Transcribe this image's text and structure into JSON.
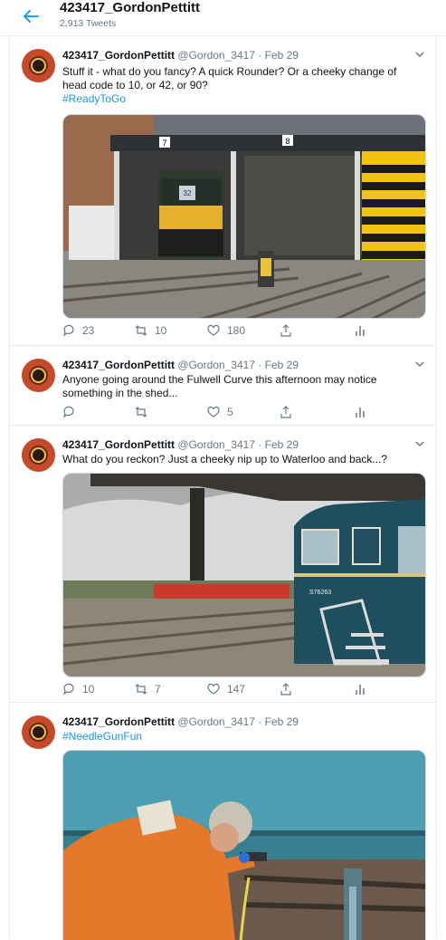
{
  "header": {
    "title": "423417_GordonPettitt",
    "tweet_count": "2,913 Tweets",
    "accent": "#1da1f2"
  },
  "tweets": [
    {
      "name": "423417_GordonPettitt",
      "handle": "@Gordon_3417",
      "sep": "·",
      "date": "Feb 29",
      "line1": "Stuff it - what do you fancy? A quick Rounder? Or a cheeky change of",
      "line2": "head code to 10, or 42, or 90?",
      "hashtag": "#ReadyToGo",
      "replies": "23",
      "retweets": "10",
      "likes": "180",
      "media_desc": "train depot"
    },
    {
      "name": "423417_GordonPettitt",
      "handle": "@Gordon_3417",
      "sep": "·",
      "date": "Feb 29",
      "line1": "Anyone going around the Fulwell Curve this afternoon may notice",
      "line2": "something in the shed...",
      "replies": "",
      "retweets": "",
      "likes": "5"
    },
    {
      "name": "423417_GordonPettitt",
      "handle": "@Gordon_3417",
      "sep": "·",
      "date": "Feb 29",
      "line1": "What do you reckon? Just a cheeky nip up to Waterloo and back...?",
      "replies": "10",
      "retweets": "7",
      "likes": "147",
      "unit_number": "S76263"
    },
    {
      "name": "423417_GordonPettitt",
      "handle": "@Gordon_3417",
      "sep": "·",
      "date": "Feb 29",
      "hashtag": "#NeedleGunFun"
    }
  ],
  "depot_numbers": [
    "7",
    "8"
  ],
  "icons": {
    "back": "back-arrow-icon",
    "reply": "reply-icon",
    "retweet": "retweet-icon",
    "like": "heart-icon",
    "share": "share-icon",
    "analytics": "analytics-icon",
    "more": "chevron-down-icon"
  }
}
